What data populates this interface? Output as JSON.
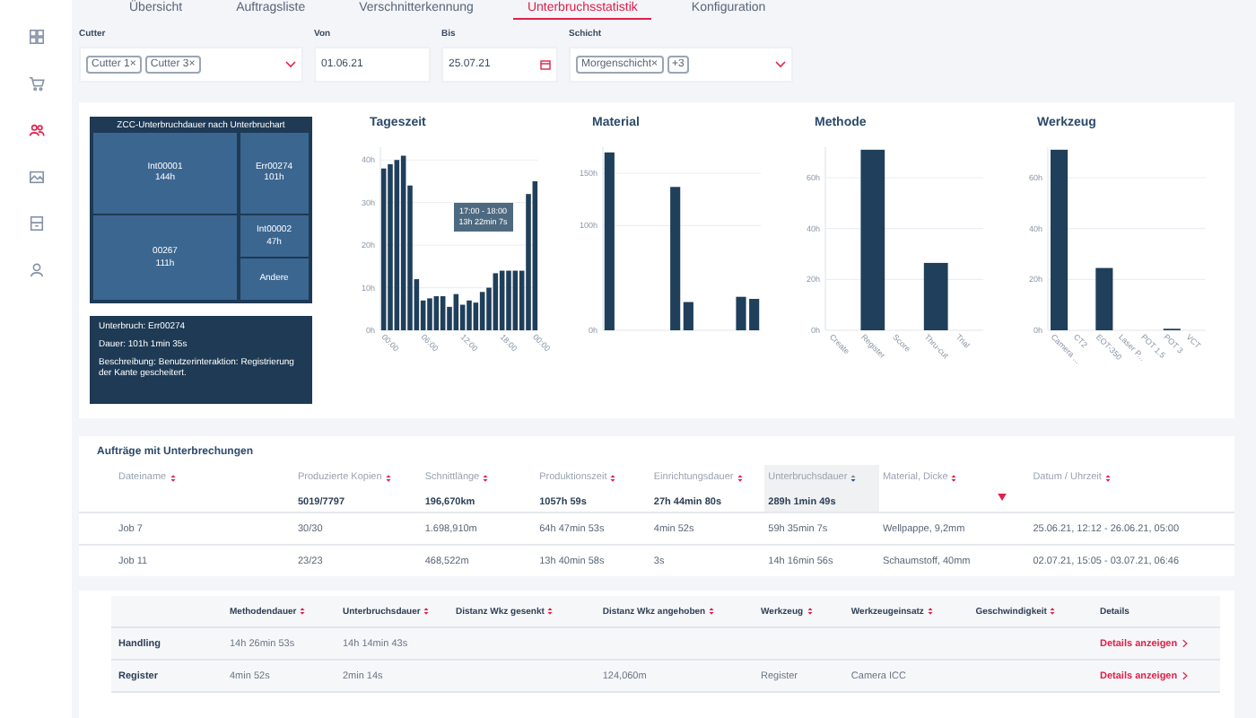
{
  "sidebar": {
    "items": [
      {
        "selected": false
      },
      {
        "selected": false
      },
      {
        "selected": true
      },
      {
        "selected": false
      },
      {
        "selected": false
      },
      {
        "selected": false
      }
    ]
  },
  "tabs": [
    {
      "label": "Übersicht",
      "selected": false
    },
    {
      "label": "Auftragsliste",
      "selected": false
    },
    {
      "label": "Verschnitterkennung",
      "selected": false
    },
    {
      "label": "Unterbruchsstatistik",
      "selected": true
    },
    {
      "label": "Konfiguration",
      "selected": false
    }
  ],
  "filters": {
    "cutter": {
      "label": "Cutter",
      "chips": [
        {
          "label": "Cutter 1",
          "remove": "×"
        },
        {
          "label": "Cutter 3",
          "remove": "×"
        }
      ]
    },
    "from": {
      "label": "Von",
      "value": "01.06.21"
    },
    "to": {
      "label": "Bis",
      "value": "25.07.21"
    },
    "shift": {
      "label": "Schicht",
      "chips": [
        {
          "label": "Morgenschicht",
          "remove": "×"
        },
        {
          "label": "+3"
        }
      ]
    }
  },
  "treemap": {
    "title": "ZCC-Unterbruchdauer nach Unterbruchart",
    "cells": [
      {
        "label": "Int00001",
        "value": "144h"
      },
      {
        "label": "00267",
        "value": "111h"
      },
      {
        "label": "Err00274",
        "value": "101h"
      },
      {
        "label": "Int00002",
        "value": "47h"
      },
      {
        "label": "Andere"
      }
    ]
  },
  "detail": {
    "lines": [
      "Unterbruch: Err00274",
      "Dauer: 101h 1min 35s",
      "Beschreibung: Benutzerinteraktion: Registrierung der Kante gescheitert."
    ]
  },
  "charts": [
    {
      "tooltip": [
        "17:00 - 18:00",
        "13h 22min 7s"
      ],
      "chart_data": {
        "type": "bar",
        "title": "Tageszeit",
        "grid": true,
        "ylim": [
          0,
          43
        ],
        "yticks": [
          {
            "value": 0,
            "label": "0h"
          },
          {
            "value": 10,
            "label": "10h"
          },
          {
            "value": 20,
            "label": "20h"
          },
          {
            "value": 30,
            "label": "30h"
          },
          {
            "value": 40,
            "label": "40h"
          }
        ],
        "categories": [
          "00:00",
          null,
          null,
          null,
          null,
          null,
          "06:00",
          null,
          null,
          null,
          null,
          null,
          "12:00",
          null,
          null,
          null,
          null,
          null,
          "18:00",
          null,
          null,
          null,
          null,
          "00:00"
        ],
        "values": [
          38,
          39,
          40,
          41,
          34,
          12,
          7,
          7.5,
          8,
          8,
          5.5,
          8.5,
          6,
          7,
          6.5,
          9,
          10,
          13.4,
          14,
          14,
          14,
          14,
          32,
          35
        ]
      }
    },
    {
      "chart_data": {
        "type": "bar",
        "title": "Material",
        "grid": true,
        "ylim": [
          0,
          175
        ],
        "yticks": [
          {
            "value": 0,
            "label": "0h"
          },
          {
            "value": 100,
            "label": "100h"
          },
          {
            "value": 150,
            "label": "150h"
          }
        ],
        "values": [
          170,
          0,
          0,
          0,
          0,
          137,
          27,
          0,
          0,
          0,
          32,
          30
        ]
      }
    },
    {
      "chart_data": {
        "type": "bar",
        "title": "Methode",
        "grid": true,
        "ylim": [
          0,
          72
        ],
        "categories": [
          "Create",
          "Register",
          "Score",
          "Thru-cut",
          "Trial"
        ],
        "yticks": [
          {
            "value": 0,
            "label": "0h"
          },
          {
            "value": 20,
            "label": "20h"
          },
          {
            "value": 40,
            "label": "40h"
          },
          {
            "value": 60,
            "label": "60h"
          }
        ],
        "values": [
          0,
          71,
          0,
          26.5,
          0
        ]
      }
    },
    {
      "chart_data": {
        "type": "bar",
        "title": "Werkzeug",
        "grid": true,
        "ylim": [
          0,
          72
        ],
        "categories": [
          "Camera ...",
          "CT2",
          "EOT-350",
          "Laser P...",
          "POT 1.5",
          "POT 3",
          "VCT"
        ],
        "yticks": [
          {
            "value": 0,
            "label": "0h"
          },
          {
            "value": 20,
            "label": "20h"
          },
          {
            "value": 40,
            "label": "40h"
          },
          {
            "value": 60,
            "label": "60h"
          }
        ],
        "values": [
          71,
          0,
          24.5,
          0,
          0,
          0.6,
          0
        ]
      }
    }
  ],
  "orders": {
    "title": "Aufträge mit Unterbrechungen",
    "columns": [
      {
        "kind": "text",
        "label": "Dateiname",
        "sorted": false
      },
      {
        "kind": "text",
        "label": "Produzierte Kopien",
        "total": "5019/7797",
        "sorted": false
      },
      {
        "kind": "text",
        "label": "Schnittlänge",
        "total": "196,670km",
        "sorted": false
      },
      {
        "kind": "text",
        "label": "Produktionszeit",
        "total": "1057h 59s",
        "sorted": false
      },
      {
        "kind": "text",
        "label": "Einrichtungsdauer",
        "total": "27h 44min 80s",
        "sorted": false
      },
      {
        "kind": "text",
        "label": "Unterbruchsdauer",
        "total": "289h 1min 49s",
        "sorted": true
      },
      {
        "kind": "text",
        "label": "Material, Dicke",
        "sorted": false
      },
      {
        "kind": "marker",
        "sorted": false
      },
      {
        "kind": "text",
        "label": "Datum / Uhrzeit",
        "sorted": false
      }
    ],
    "rows": [
      [
        "Job 7",
        "30/30",
        "1.698,910m",
        "64h 47min 53s",
        "4min 52s",
        "59h 35min 7s",
        "Wellpappe, 9,2mm",
        null,
        "25.06.21, 12:12 - 26.06.21, 05:00"
      ],
      [
        "Job 11",
        "23/23",
        "468,522m",
        "13h 40min 58s",
        "3s",
        "14h 16min 56s",
        "Schaumstoff, 40mm",
        null,
        "02.07.21, 15:05 - 03.07.21, 06:46"
      ]
    ]
  },
  "methods": {
    "columns": [
      null,
      "Methodendauer",
      "Unterbruchsdauer",
      "Distanz Wkz gesenkt",
      "Distanz Wkz angehoben",
      "Werkzeug",
      "Werkzeugeinsatz",
      "Geschwindigkeit",
      "Details"
    ],
    "rows": [
      {
        "cells": [
          "Handling",
          "14h 26min 53s",
          "14h 14min 43s",
          null,
          null,
          null,
          null,
          null
        ],
        "link": "Details anzeigen"
      },
      {
        "cells": [
          "Register",
          "4min 52s",
          "2min 14s",
          null,
          "124,060m",
          "Register",
          "Camera ICC",
          null
        ],
        "link": "Details anzeigen"
      }
    ]
  }
}
